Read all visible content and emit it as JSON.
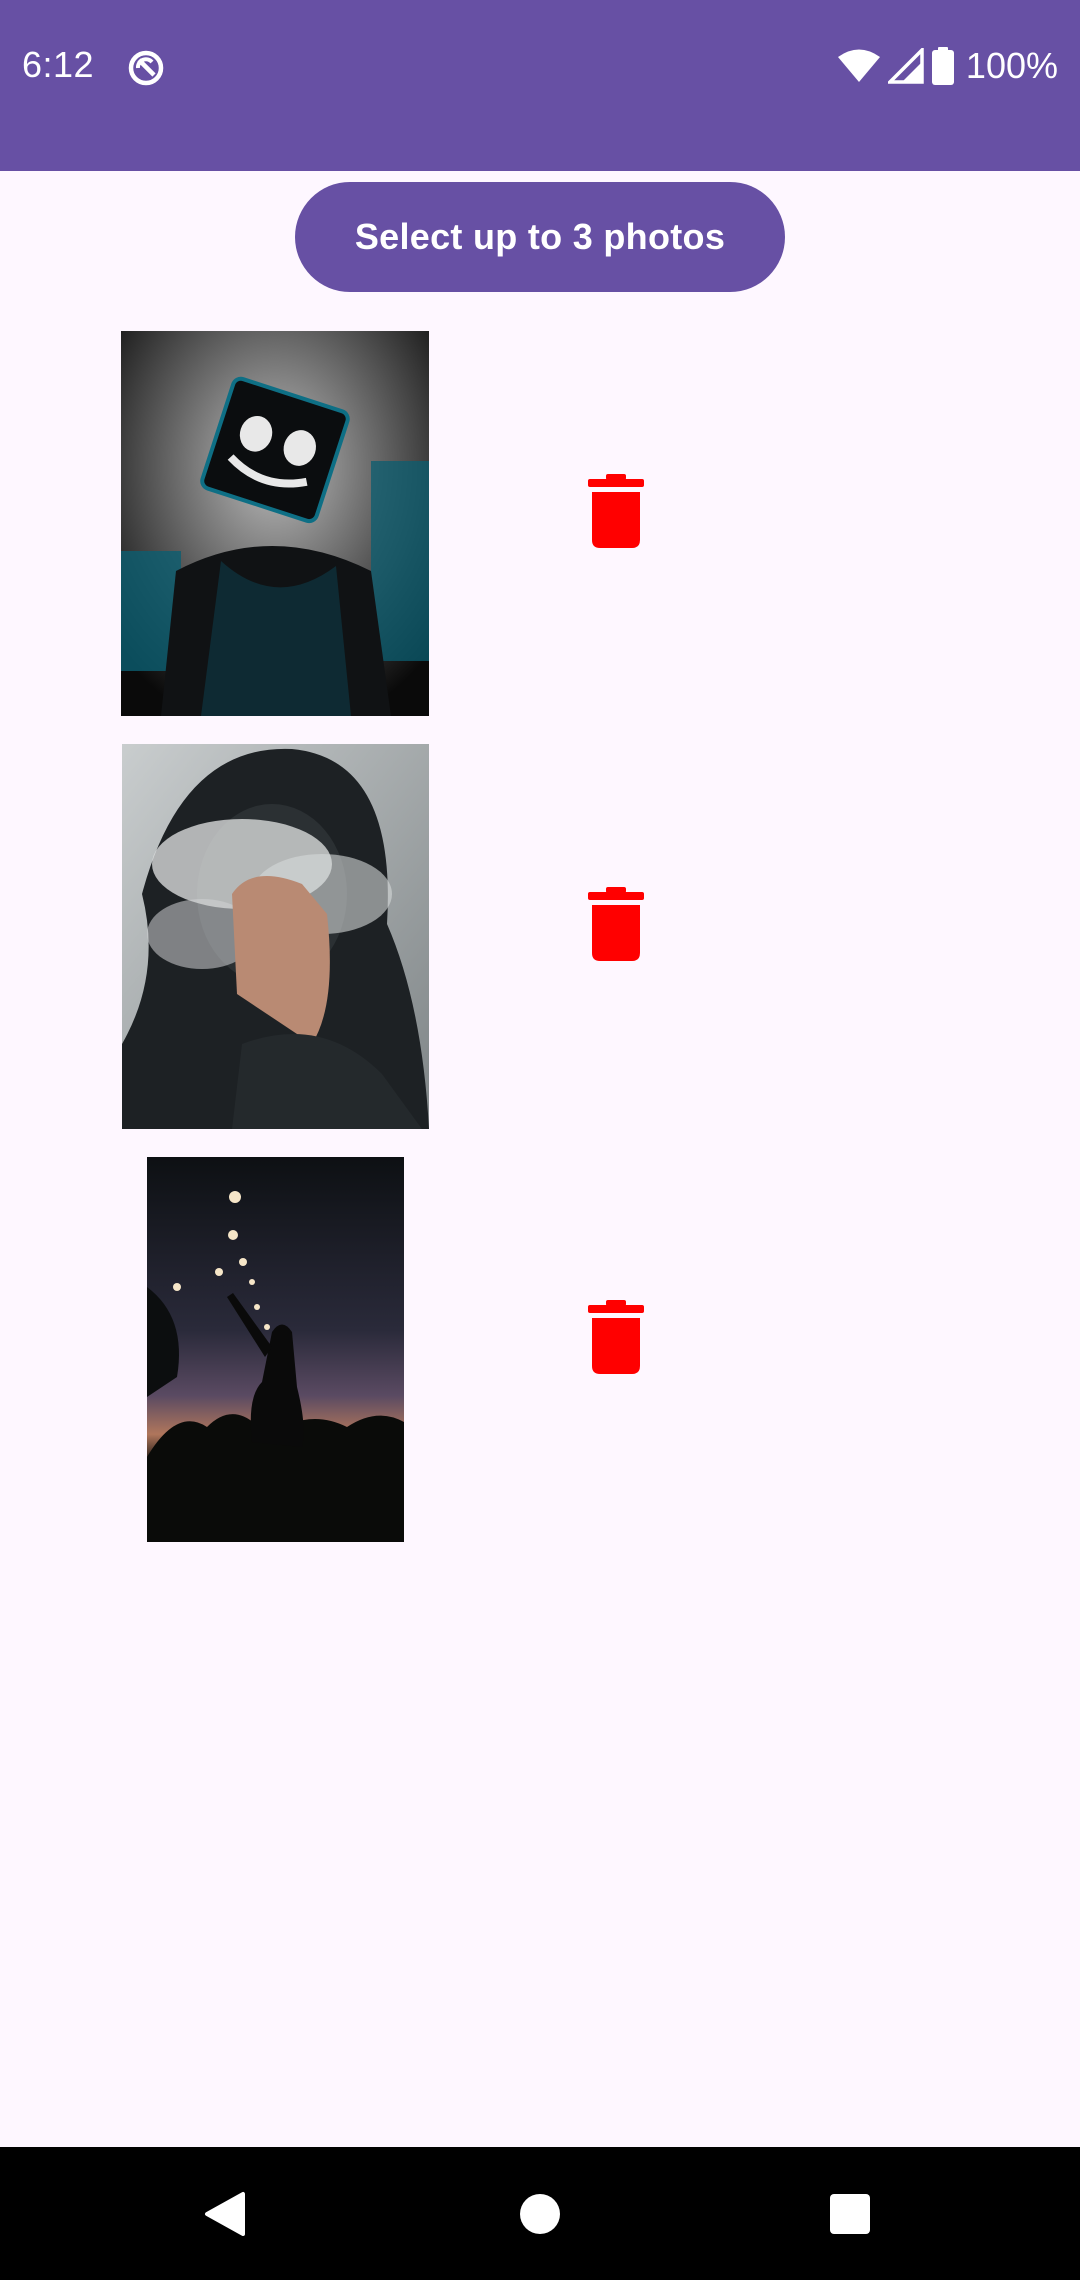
{
  "status_bar": {
    "time": "6:12",
    "battery_percent": "100%",
    "background_color": "#6750A4",
    "icons": [
      "app-notification-icon",
      "wifi-icon",
      "cell-signal-icon",
      "battery-icon"
    ]
  },
  "main": {
    "select_button_label": "Select up to 3 photos",
    "accent_color": "#6750A4",
    "delete_icon_color": "#FF0000",
    "photos": [
      {
        "description_icon": "photo-thumbnail",
        "delete_icon": "trash-icon"
      },
      {
        "description_icon": "photo-thumbnail",
        "delete_icon": "trash-icon"
      },
      {
        "description_icon": "photo-thumbnail",
        "delete_icon": "trash-icon"
      }
    ]
  },
  "nav_bar": {
    "icons": [
      "back-icon",
      "home-icon",
      "recents-icon"
    ]
  }
}
